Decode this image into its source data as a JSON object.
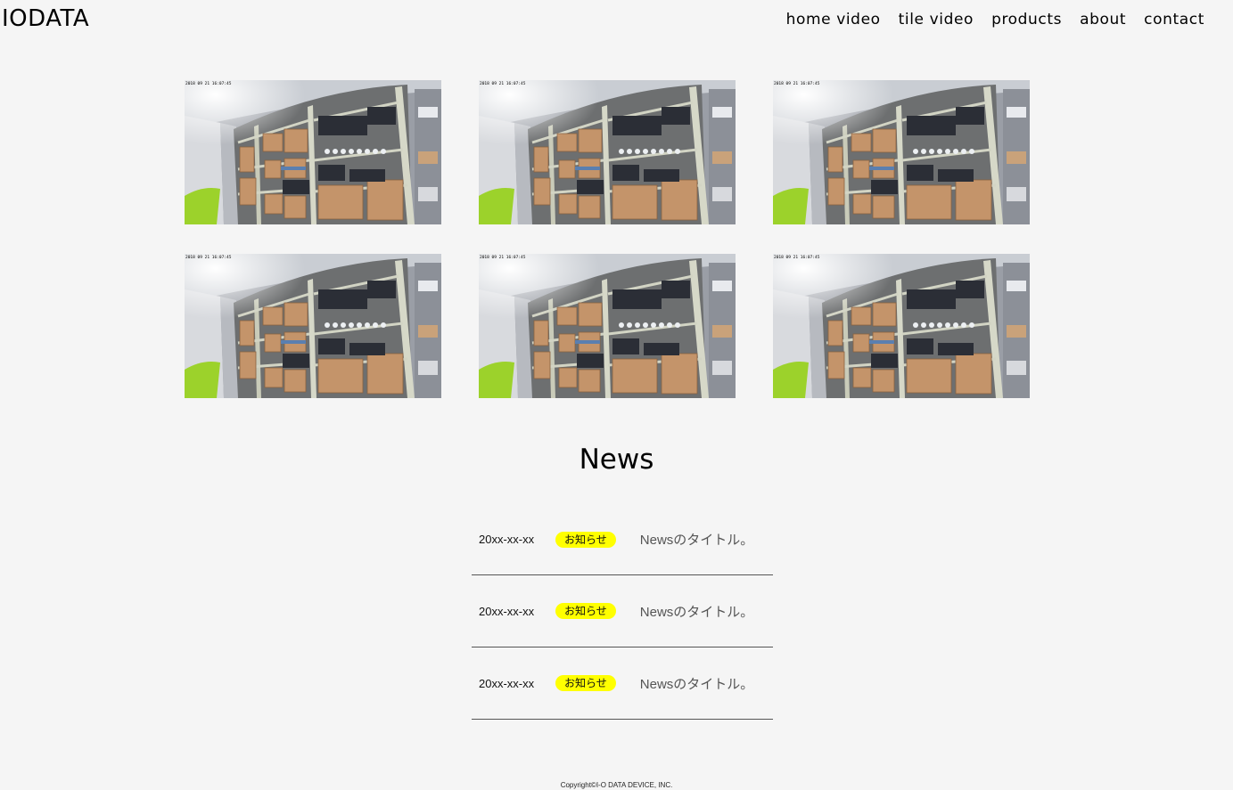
{
  "header": {
    "logo": "IODATA",
    "nav": [
      {
        "label": "home video"
      },
      {
        "label": "tile video"
      },
      {
        "label": "products"
      },
      {
        "label": "about"
      },
      {
        "label": "contact"
      }
    ]
  },
  "videos": {
    "tiles": [
      {
        "timestamp": "2018 09 21 16:07:45"
      },
      {
        "timestamp": "2018 09 21 16:07:45"
      },
      {
        "timestamp": "2018 09 21 16:07:45"
      },
      {
        "timestamp": "2018 09 21 16:07:45"
      },
      {
        "timestamp": "2018 09 21 16:07:45"
      },
      {
        "timestamp": "2018 09 21 16:07:45"
      }
    ]
  },
  "news": {
    "title": "News",
    "items": [
      {
        "date": "20xx-xx-xx",
        "tag": "お知らせ",
        "headline": "Newsのタイトル。"
      },
      {
        "date": "20xx-xx-xx",
        "tag": "お知らせ",
        "headline": "Newsのタイトル。"
      },
      {
        "date": "20xx-xx-xx",
        "tag": "お知らせ",
        "headline": "Newsのタイトル。"
      }
    ]
  },
  "footer": {
    "copyright": "Copyright©I-O DATA DEVICE, INC."
  },
  "colors": {
    "background": "#f5f5f5",
    "tag_highlight": "#ffff00",
    "divider": "#555555"
  }
}
